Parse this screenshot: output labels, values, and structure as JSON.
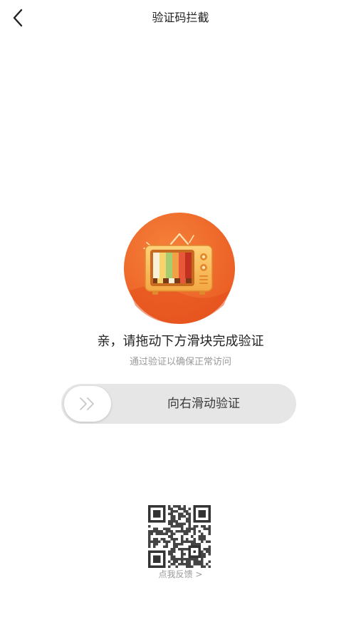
{
  "nav": {
    "back_icon": "chevron-left-icon",
    "title": "验证码拦截"
  },
  "hero": {
    "icon": "retro-tv-icon",
    "circle_color": "#f0652a"
  },
  "prompt": {
    "title": "亲，请拖动下方滑块完成验证",
    "subtitle": "通过验证以确保正常访问"
  },
  "slider": {
    "label": "向右滑动验证",
    "handle_icon": "double-chevron-right-icon",
    "progress": 0
  },
  "feedback": {
    "qr_icon": "qr-code-icon",
    "link_text": "点我反馈 >"
  }
}
